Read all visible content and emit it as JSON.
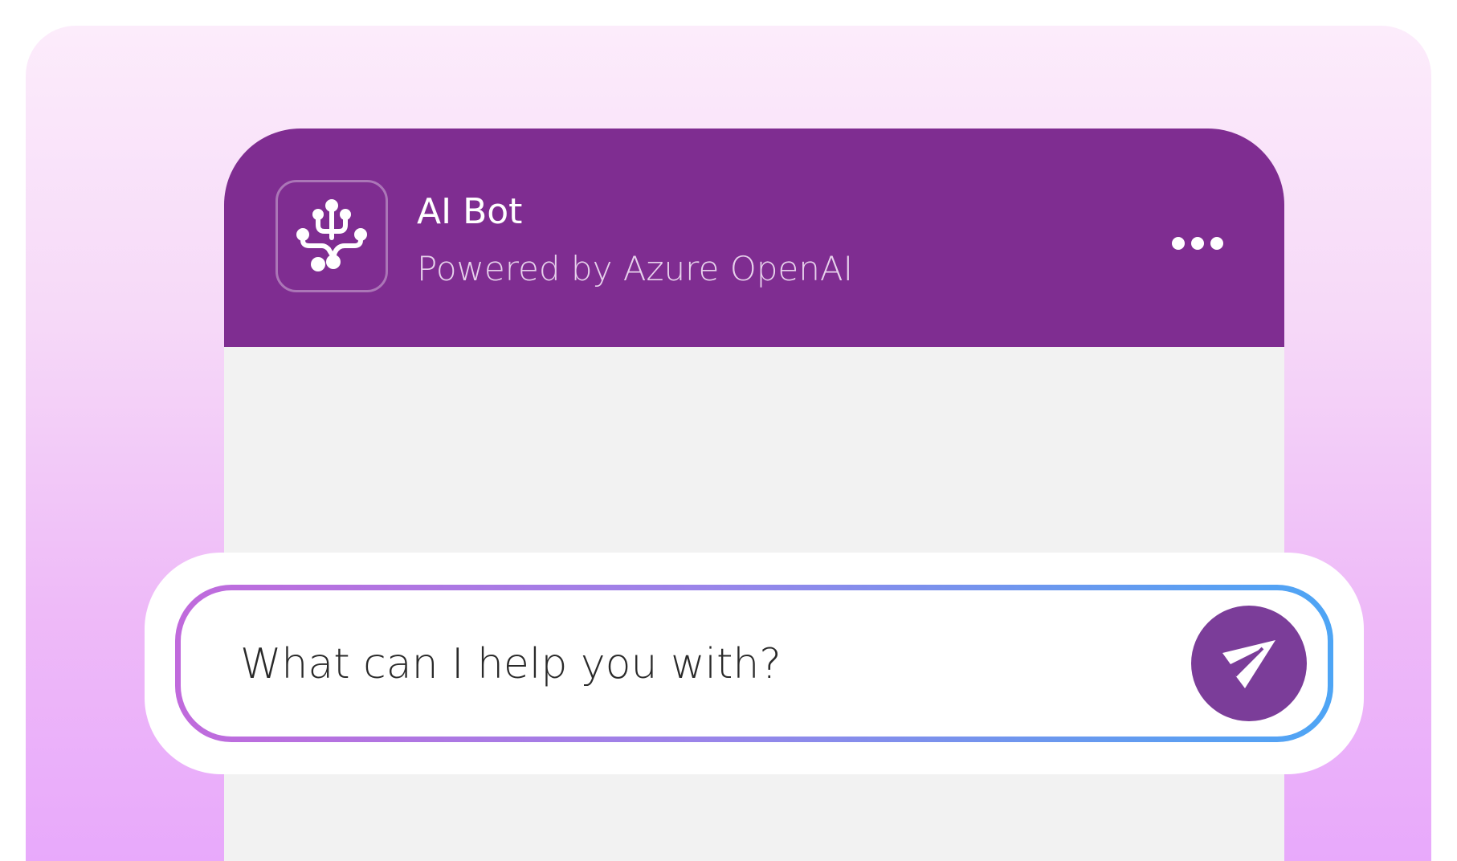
{
  "header": {
    "title": "AI Bot",
    "subtitle": "Powered by Azure OpenAI",
    "bot_icon": "circuit-network-icon",
    "menu_icon": "more-options-icon"
  },
  "composer": {
    "placeholder": "What can I help you with?",
    "value": "",
    "send_icon": "paper-plane-send-icon"
  },
  "colors": {
    "header_background": "#7f2d91",
    "send_button": "#7b3d99",
    "chat_background": "#f2f2f2",
    "input_border_start": "#c06adc",
    "input_border_end": "#4ea5f5",
    "page_gradient_top": "#fcecfb",
    "page_gradient_bottom": "#e8a9fb"
  }
}
